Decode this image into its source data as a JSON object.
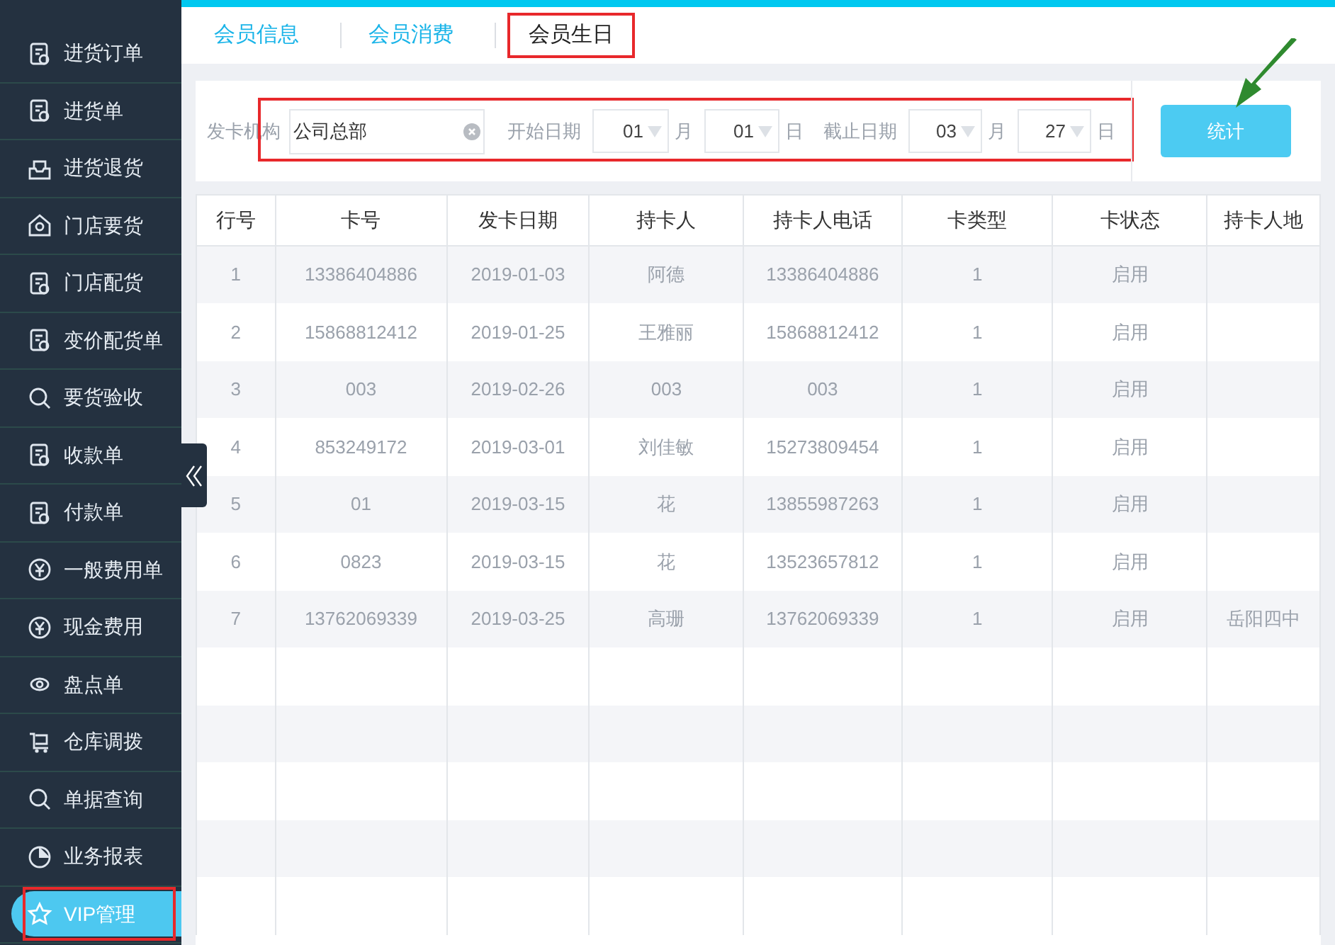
{
  "sidebar": {
    "items": [
      {
        "label": "进货订单",
        "selected": false
      },
      {
        "label": "进货单",
        "selected": false
      },
      {
        "label": "进货退货",
        "selected": false
      },
      {
        "label": "门店要货",
        "selected": false
      },
      {
        "label": "门店配货",
        "selected": false
      },
      {
        "label": "变价配货单",
        "selected": false
      },
      {
        "label": "要货验收",
        "selected": false
      },
      {
        "label": "收款单",
        "selected": false
      },
      {
        "label": "付款单",
        "selected": false
      },
      {
        "label": "一般费用单",
        "selected": false
      },
      {
        "label": "现金费用",
        "selected": false
      },
      {
        "label": "盘点单",
        "selected": false
      },
      {
        "label": "仓库调拨",
        "selected": false
      },
      {
        "label": "单据查询",
        "selected": false
      },
      {
        "label": "业务报表",
        "selected": false
      },
      {
        "label": "VIP管理",
        "selected": true
      }
    ]
  },
  "tabs": [
    {
      "label": "会员信息",
      "selected": false
    },
    {
      "label": "会员消费",
      "selected": false
    },
    {
      "label": "会员生日",
      "selected": true
    }
  ],
  "filter": {
    "issuer_label": "发卡机构",
    "issuer_value": "公司总部",
    "start_label": "开始日期",
    "start_month": "01",
    "month_unit_1": "月",
    "start_day": "01",
    "day_unit_1": "日",
    "end_label": "截止日期",
    "end_month": "03",
    "month_unit_2": "月",
    "end_day": "27",
    "day_unit_2": "日",
    "button": "统计"
  },
  "table": {
    "columns": [
      "行号",
      "卡号",
      "发卡日期",
      "持卡人",
      "持卡人电话",
      "卡类型",
      "卡状态",
      "持卡人地"
    ],
    "rows": [
      [
        "1",
        "13386404886",
        "2019-01-03",
        "阿德",
        "13386404886",
        "1",
        "启用",
        ""
      ],
      [
        "2",
        "15868812412",
        "2019-01-25",
        "王雅丽",
        "15868812412",
        "1",
        "启用",
        ""
      ],
      [
        "3",
        "003",
        "2019-02-26",
        "003",
        "003",
        "1",
        "启用",
        ""
      ],
      [
        "4",
        "853249172",
        "2019-03-01",
        "刘佳敏",
        "15273809454",
        "1",
        "启用",
        ""
      ],
      [
        "5",
        "01",
        "2019-03-15",
        "花",
        "13855987263",
        "1",
        "启用",
        ""
      ],
      [
        "6",
        "0823",
        "2019-03-15",
        "花",
        "13523657812",
        "1",
        "启用",
        ""
      ],
      [
        "7",
        "13762069339",
        "2019-03-25",
        "高珊",
        "13762069339",
        "1",
        "启用",
        "岳阳四中"
      ]
    ]
  }
}
